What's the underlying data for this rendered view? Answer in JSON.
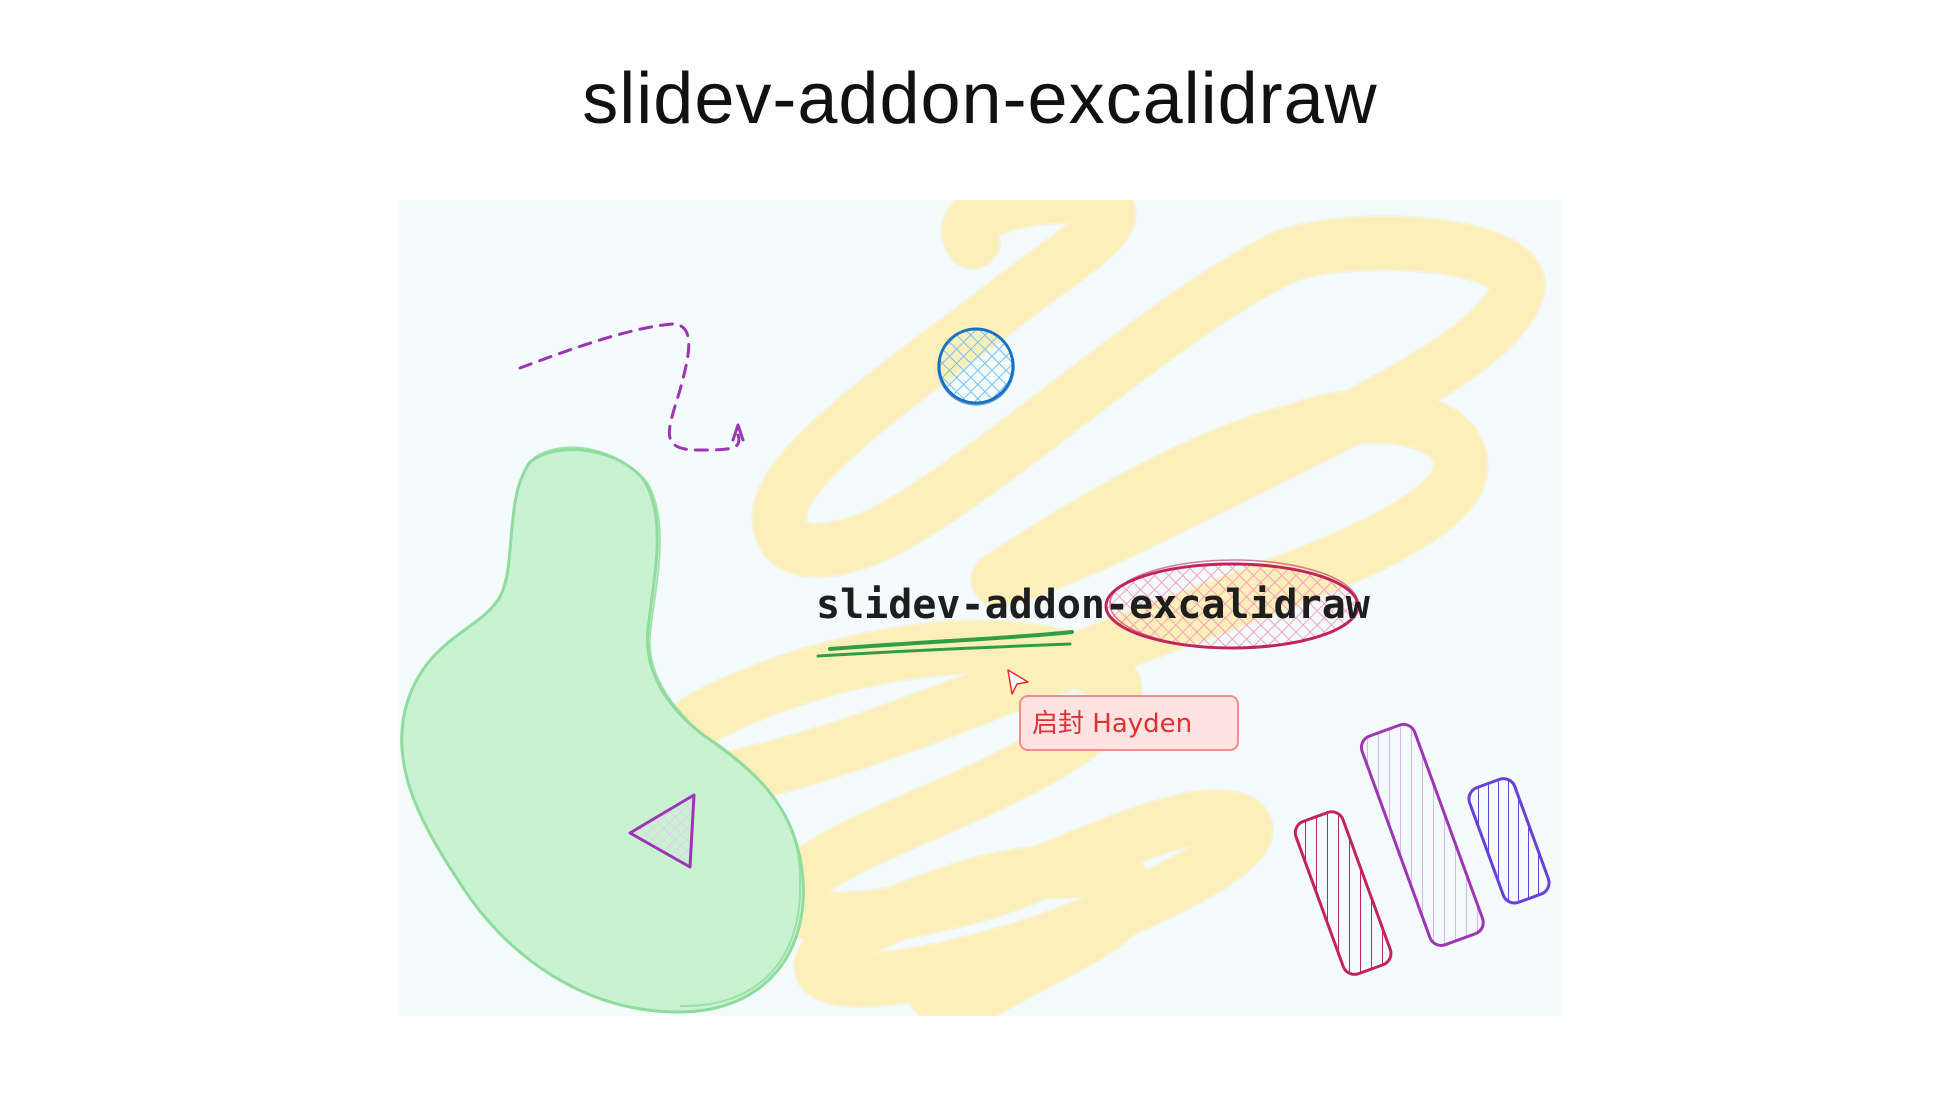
{
  "slide": {
    "title": "slidev-addon-excalidraw"
  },
  "canvas": {
    "center_text": "slidev-addon-excalidraw",
    "collaborator": {
      "name": "启封 Hayden",
      "color": "#e03131"
    }
  },
  "colors": {
    "canvas_background": "#f3fbfc",
    "scribble_fill": "#fdf3c8",
    "blob_fill": "#c9f2d2",
    "blob_stroke": "#8fdc9c",
    "dashed_arrow": "#9c36b5",
    "circle_stroke": "#1971c2",
    "underline": "#2f9e44",
    "ellipse_stroke": "#c2255c",
    "bar_crimson": "#c2255c",
    "bar_violet": "#9c36b5",
    "bar_indigo": "#6741d9"
  }
}
